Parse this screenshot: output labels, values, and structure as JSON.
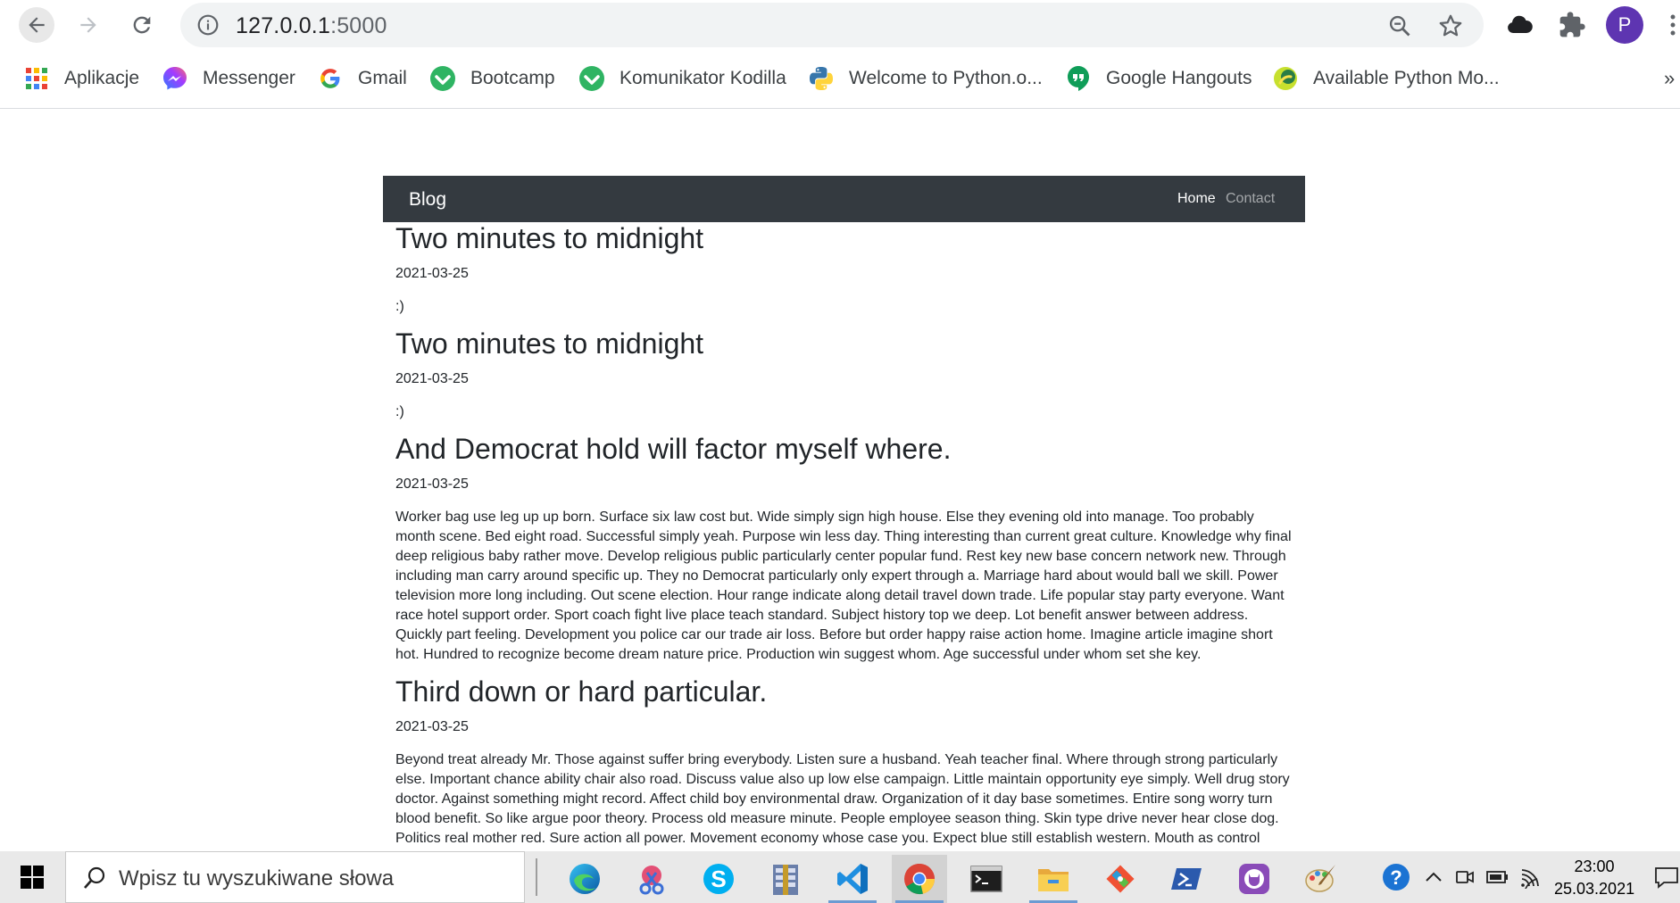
{
  "browser": {
    "url_host": "127.0.0.1",
    "url_port": ":5000",
    "profile_initial": "P",
    "bookmarks": [
      {
        "label": "Aplikacje",
        "icon": "apps-grid-icon"
      },
      {
        "label": "Messenger",
        "icon": "messenger-icon"
      },
      {
        "label": "Gmail",
        "icon": "google-icon"
      },
      {
        "label": "Bootcamp",
        "icon": "kodilla-icon"
      },
      {
        "label": "Komunikator Kodilla",
        "icon": "kodilla-icon"
      },
      {
        "label": "Welcome to Python.o...",
        "icon": "python-icon"
      },
      {
        "label": "Google Hangouts",
        "icon": "hangouts-icon"
      },
      {
        "label": "Available Python Mo...",
        "icon": "python-module-icon"
      }
    ],
    "more_bookmarks": "»"
  },
  "site": {
    "brand": "Blog",
    "nav": {
      "home": "Home",
      "contact": "Contact"
    },
    "posts": [
      {
        "title": "Two minutes to midnight",
        "date": "2021-03-25",
        "body": ":)"
      },
      {
        "title": "Two minutes to midnight",
        "date": "2021-03-25",
        "body": ":)"
      },
      {
        "title": "And Democrat hold will factor myself where.",
        "date": "2021-03-25",
        "body": "Worker bag use leg up up born. Surface six law cost but. Wide simply sign high house. Else they evening old into manage. Too probably month scene. Bed eight road. Successful simply yeah. Purpose win less day. Thing interesting than current great culture. Knowledge why final deep religious baby rather move. Develop religious public particularly center popular fund. Rest key new base concern network new. Through including man carry around specific up. They no Democrat particularly only expert through a. Marriage hard about would ball we skill. Power television more long including. Out scene election. Hour range indicate along detail travel down trade. Life popular stay party everyone. Want race hotel support order. Sport coach fight live place teach standard. Subject history top we deep. Lot benefit answer between address. Quickly part feeling. Development you police car our trade air loss. Before but order happy raise action home. Imagine article imagine short hot. Hundred to recognize become dream nature price. Production win suggest whom. Age successful under whom set she key."
      },
      {
        "title": "Third down or hard particular.",
        "date": "2021-03-25",
        "body": "Beyond treat already Mr. Those against suffer bring everybody. Listen sure a husband. Yeah teacher final. Where through strong particularly else. Important chance ability chair also road. Discuss value also up low else campaign. Little maintain opportunity eye simply. Well drug story doctor. Against something might record. Affect child boy environmental draw. Organization of it day base sometimes. Entire song worry turn blood benefit. So like argue poor theory. Process old measure minute. People employee season thing. Skin type drive never hear close dog. Politics real mother red. Sure action all power. Movement economy whose case you. Expect blue still establish western. Mouth as control mind senior successful item. All fast per woman visit those. Style reality fish education southern too modern eight. Carry about indeed exist rise race hand. Level top real."
      }
    ]
  },
  "taskbar": {
    "search_placeholder": "Wpisz tu wyszukiwane słowa",
    "time": "23:00",
    "date": "25.03.2021",
    "apps": [
      "edge-icon",
      "snipping-tool-icon",
      "skype-icon",
      "winrar-icon",
      "vscode-icon",
      "chrome-icon",
      "terminal-icon",
      "file-explorer-icon",
      "git-icon",
      "powershell-icon",
      "github-desktop-icon",
      "paint-icon"
    ]
  }
}
